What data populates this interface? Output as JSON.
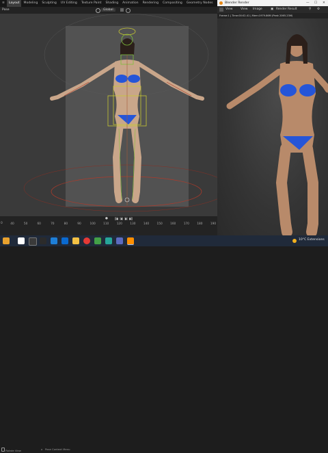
{
  "main_window": {
    "workspace_tabs": [
      {
        "label": "Layout",
        "active": true
      },
      {
        "label": "Modeling",
        "active": false
      },
      {
        "label": "Sculpting",
        "active": false
      },
      {
        "label": "UV Editing",
        "active": false
      },
      {
        "label": "Texture Paint",
        "active": false
      },
      {
        "label": "Shading",
        "active": false
      },
      {
        "label": "Animation",
        "active": false
      },
      {
        "label": "Rendering",
        "active": false
      },
      {
        "label": "Compositing",
        "active": false
      },
      {
        "label": "Geometry Nodes",
        "active": false
      },
      {
        "label": "Scripting",
        "active": false
      }
    ],
    "mode_label": "Pose",
    "orientation_label": "Global"
  },
  "timeline": {
    "current_frame": "0",
    "ticks": [
      "40",
      "50",
      "60",
      "70",
      "80",
      "90",
      "100",
      "110",
      "120",
      "130",
      "140",
      "150",
      "160",
      "170",
      "180",
      "190"
    ]
  },
  "statusbar": {
    "left": "Rotate View",
    "middle": "Pose Context Menu"
  },
  "render_window": {
    "title": "Blender Render",
    "menu": {
      "view": "View",
      "view_label": "View",
      "image_label": "Image",
      "slot_label": "Render Result"
    },
    "info": "Frame:1 | Time:00:02.41 | Mem:1979.86M (Peak 2065.23M)"
  },
  "taskbar": {
    "weather": "10°C  Extensions"
  },
  "colors": {
    "accent": "#4a78b5",
    "bikini": "#2555d8",
    "bone_yellow": "#c8c832",
    "bone_green": "#7fbf3a",
    "bone_red": "#b03a2a"
  }
}
